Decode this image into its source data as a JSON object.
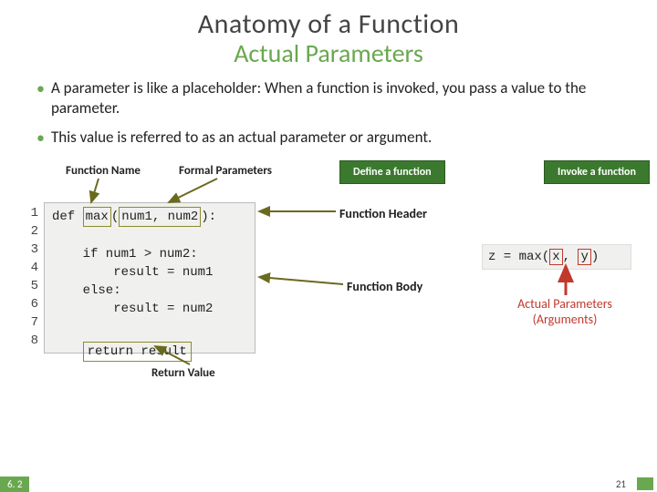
{
  "title": {
    "main": "Anatomy of a Function",
    "sub": "Actual Parameters"
  },
  "bullets": [
    "A parameter is like a placeholder: When a function is invoked, you pass a value to the parameter.",
    "This value is referred to as an actual parameter or argument."
  ],
  "labels": {
    "function_name": "Function Name",
    "formal_params": "Formal Parameters",
    "define": "Define a function",
    "invoke": "Invoke a function",
    "function_header": "Function Header",
    "function_body": "Function Body",
    "return_value": "Return Value",
    "actual_params": "Actual Parameters\n(Arguments)"
  },
  "code": {
    "line_numbers": [
      "1",
      "2",
      "3",
      "4",
      "5",
      "6",
      "7",
      "8"
    ],
    "def_kw": "def",
    "fn_name": "max",
    "params": "num1, num2",
    "body1": "    if num1 > num2:",
    "body2": "        result = num1",
    "body3": "    else:",
    "body4": "        result = num2",
    "ret": "return result"
  },
  "invoke_code": {
    "prefix": "z = max(",
    "arg1": "x",
    "sep": ", ",
    "arg2": "y",
    "suffix": ")"
  },
  "footer": {
    "section": "6. 2",
    "page": "21"
  }
}
